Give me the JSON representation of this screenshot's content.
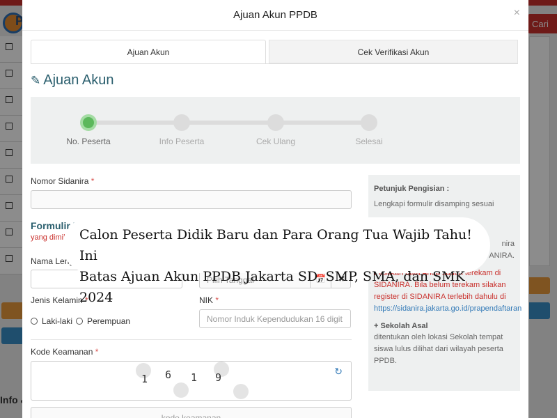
{
  "background": {
    "logo_text": "P",
    "search_button": "Cari",
    "footer_fragment": "Info &"
  },
  "modal": {
    "title": "Ajuan Akun PPDB",
    "close_label": "×",
    "tabs": [
      {
        "label": "Ajuan Akun",
        "active": true
      },
      {
        "label": "Cek Verifikasi Akun",
        "active": false
      }
    ],
    "section_title": "Ajuan Akun",
    "steps": [
      {
        "label": "No. Peserta",
        "active": true
      },
      {
        "label": "Info Peserta",
        "active": false
      },
      {
        "label": "Cek Ulang",
        "active": false
      },
      {
        "label": "Selesai",
        "active": false
      }
    ],
    "form": {
      "nomor_label": "Nomor Sidanira",
      "required_mark": "*",
      "formulir_title": "Formulir D",
      "formulir_sub": "yang dimili",
      "nama_label": "Nama Leng",
      "tanggal_placeholder": "Pilih Tanggal",
      "calendar_icon": "📅",
      "clear_icon": "✖",
      "jenis_kelamin_label": "Jenis Kelamin",
      "laki_label": "Laki-laki",
      "perempuan_label": "Perempuan",
      "nik_label": "NIK",
      "nik_placeholder": "Nomor Induk Kependudukan 16 digit",
      "kode_label": "Kode Keamanan",
      "captcha_chars": [
        "1",
        "6",
        "1",
        "9"
      ],
      "refresh_icon": "↻",
      "kode_placeholder": "kode keamanan"
    },
    "side_panel": {
      "title": "Petunjuk Pengisian :",
      "line1": "Lengkapi formulir disamping sesuai",
      "line2": "nira",
      "line3": "ANIRA.",
      "red_text": "Pastikan data Anda sudah terekam di SIDANIRA. Bila belum terekam silakan register di SIDANIRA terlebih dahulu di",
      "link_text": "https://sidanira.jakarta.go.id/prapendaftaran",
      "subhead": "+ Sekolah Asal",
      "subtext": "ditentukan oleh lokasi Sekolah tempat siswa lulus dilihat dari wilayah peserta PPDB."
    }
  },
  "headline": {
    "line1": "Calon Peserta Didik Baru dan Para Orang Tua Wajib Tahu! Ini",
    "line2": "Batas Ajuan Akun PPDB Jakarta SD, SMP, SMA, dan SMK 2024"
  },
  "colors": {
    "accent": "#2b5f6e",
    "step_active": "#5cb85c",
    "required": "#d9534f",
    "link": "#337ab7"
  }
}
